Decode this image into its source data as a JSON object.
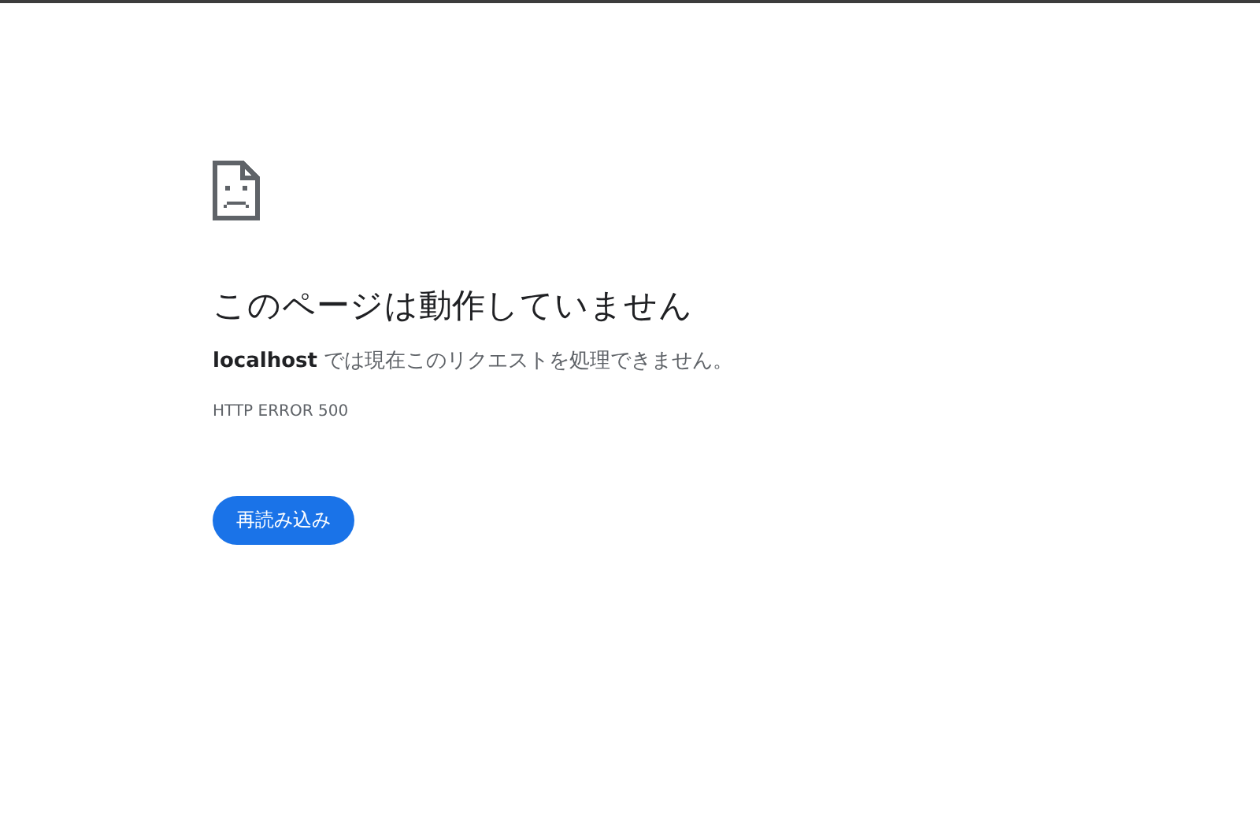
{
  "error": {
    "title": "このページは動作していません",
    "message": "**localhost** では現在このリクエストを処理できません。",
    "code": "HTTP ERROR 500"
  },
  "buttons": [
    "再読み込み"
  ]
}
